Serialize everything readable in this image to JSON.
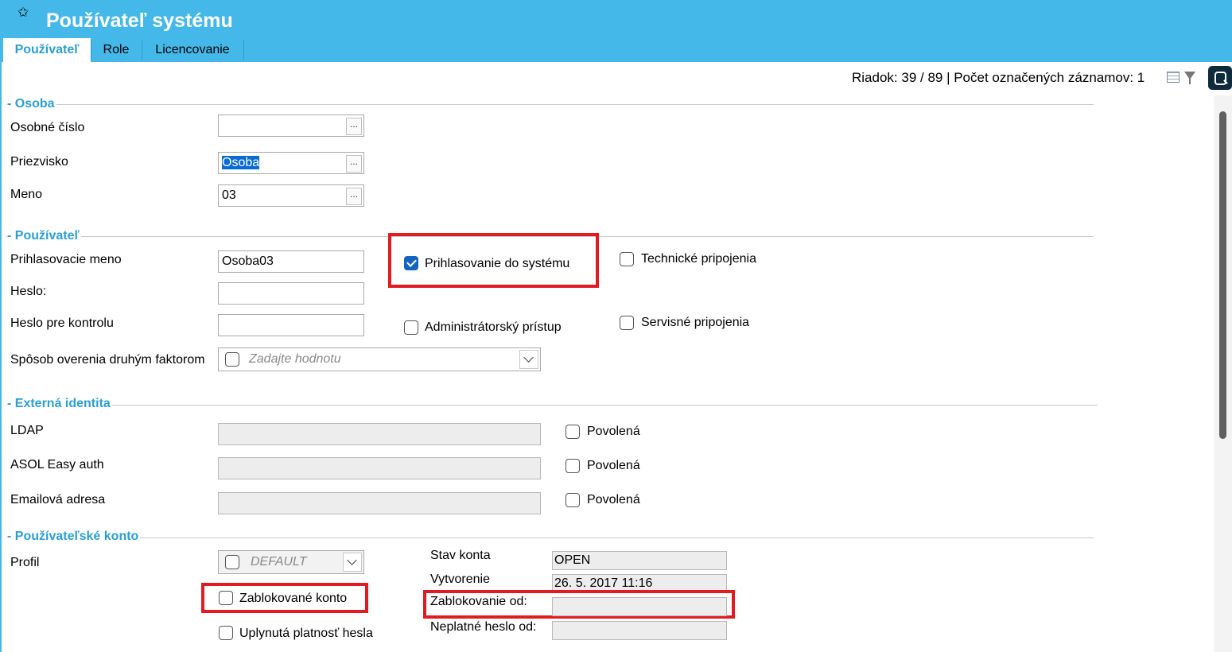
{
  "window": {
    "title": "Používateľ systému"
  },
  "tabs": [
    "Používateľ",
    "Role",
    "Licencovanie"
  ],
  "status": {
    "text": "Riadok: 39 / 89 | Počet označených záznamov: 1"
  },
  "sections": {
    "osoba": "- Osoba",
    "pouzivatel": "- Používateľ",
    "externa": "- Externá identita",
    "konto": "- Používateľské konto"
  },
  "osoba": {
    "osobne_cislo_label": "Osobné číslo",
    "osobne_cislo_value": "",
    "priezvisko_label": "Priezvisko",
    "priezvisko_value": "Osoba",
    "meno_label": "Meno",
    "meno_value": "03",
    "browse": "..."
  },
  "pouzivatel": {
    "login_label": "Prihlasovacie meno",
    "login_value": "Osoba03",
    "heslo_label": "Heslo:",
    "heslo_kontrola_label": "Heslo pre kontrolu",
    "dvojfaktor_label": "Spôsob overenia druhým faktorom",
    "dvojfaktor_placeholder": "Zadajte hodnotu",
    "prihlasovanie_label": "Prihlasovanie do systému",
    "prihlasovanie_checked": true,
    "admin_label": "Administrátorský prístup",
    "technicke_label": "Technické pripojenia",
    "servisne_label": "Servisné pripojenia"
  },
  "externa": {
    "ldap_label": "LDAP",
    "asol_label": "ASOL Easy auth",
    "email_label": "Emailová adresa",
    "povolena": "Povolená"
  },
  "konto": {
    "profil_label": "Profil",
    "profil_value": "DEFAULT",
    "zablokovane_label": "Zablokované konto",
    "uplynuta_label": "Uplynutá platnosť hesla",
    "stav_label": "Stav konta",
    "stav_value": "OPEN",
    "vytvorenie_label": "Vytvorenie",
    "vytvorenie_value": "26. 5. 2017 11:16",
    "zablokovanie_label": "Zablokovanie od:",
    "zablokovanie_value": "",
    "neplatne_label": "Neplatné heslo od:",
    "neplatne_value": ""
  },
  "colors": {
    "header": "#45b8ea",
    "accent": "#2a9fd6",
    "highlight": "#e21b23",
    "check": "#1565c0"
  }
}
